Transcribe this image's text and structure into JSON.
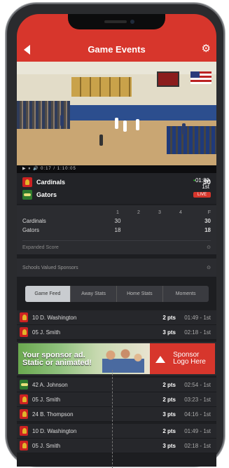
{
  "header": {
    "title": "Game Events",
    "back_icon": "back-arrow-icon",
    "settings_icon": "gear-icon"
  },
  "video": {
    "controls_text": "▶ ⏸ 🔊 0:17 / 1:10:05"
  },
  "score": {
    "teams": [
      {
        "name": "Cardinals",
        "score": "30"
      },
      {
        "name": "Gators",
        "score": "18"
      }
    ],
    "clock": "01:20",
    "period": "1st",
    "live_label": "LIVE"
  },
  "boxscore": {
    "headers": [
      "",
      "1",
      "2",
      "3",
      "4",
      "F"
    ],
    "rows": [
      {
        "team": "Cardinals",
        "q1": "30",
        "q2": "",
        "q3": "",
        "q4": "",
        "f": "30"
      },
      {
        "team": "Gators",
        "q1": "18",
        "q2": "",
        "q3": "",
        "q4": "",
        "f": "18"
      }
    ],
    "expanded_label": "Expanded Score"
  },
  "sponsors": {
    "label": "Schools Valued Sponsors"
  },
  "tabs": [
    "Game Feed",
    "Away Stats",
    "Home Stats",
    "Moments"
  ],
  "feed": [
    {
      "team": "c",
      "player": "10 D. Washington",
      "pts": "2 pts",
      "time": "01:49 - 1st"
    },
    {
      "team": "c",
      "player": "05 J. Smith",
      "pts": "3 pts",
      "time": "02:18 - 1st"
    },
    {
      "team": "g",
      "player": "42 A. Johnson",
      "pts": "2 pts",
      "time": "02:54 - 1st"
    },
    {
      "team": "c",
      "player": "05 J. Smith",
      "pts": "2 pts",
      "time": "03:23 - 1st"
    },
    {
      "team": "c",
      "player": "24 B. Thompson",
      "pts": "3 pts",
      "time": "04:16 - 1st"
    },
    {
      "team": "c",
      "player": "10 D. Washington",
      "pts": "2 pts",
      "time": "01:49 - 1st"
    },
    {
      "team": "c",
      "player": "05 J. Smith",
      "pts": "3 pts",
      "time": "02:18 - 1st"
    }
  ],
  "ad": {
    "line1": "Your sponsor ad.",
    "line2": "Static or animated!",
    "logo_line1": "Sponsor",
    "logo_line2": "Logo Here"
  }
}
